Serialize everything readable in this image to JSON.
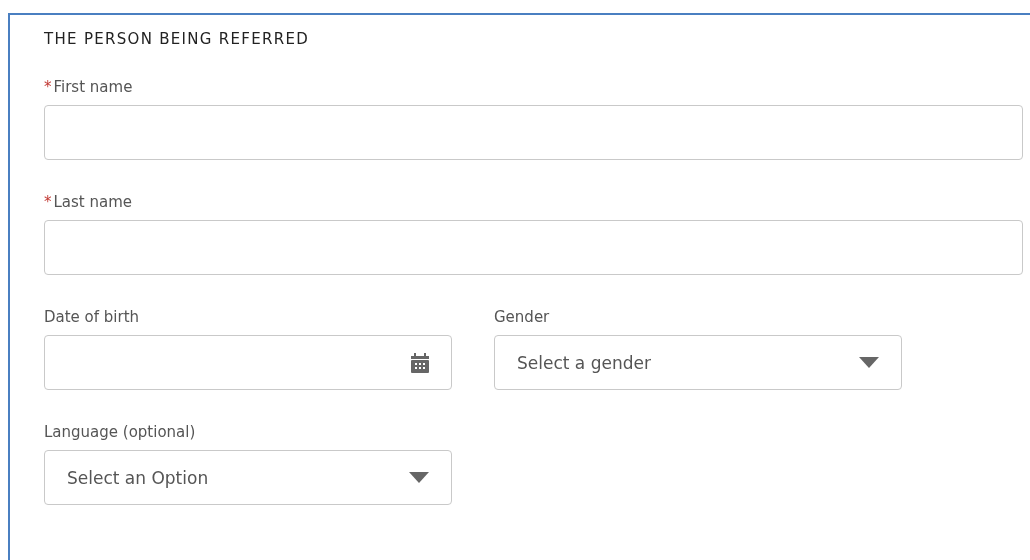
{
  "section": {
    "title": "THE PERSON BEING REFERRED"
  },
  "rows": [
    [
      {
        "kind": "text",
        "label": "First name",
        "required_mark": "*"
      }
    ],
    [
      {
        "kind": "text",
        "label": "Last name",
        "required_mark": "*"
      }
    ],
    [
      {
        "kind": "date",
        "label": "Date of birth"
      },
      {
        "kind": "select",
        "label": "Gender",
        "placeholder": "Select a gender"
      }
    ],
    [
      {
        "kind": "select",
        "label": "Language (optional)",
        "placeholder": "Select an Option"
      }
    ]
  ]
}
